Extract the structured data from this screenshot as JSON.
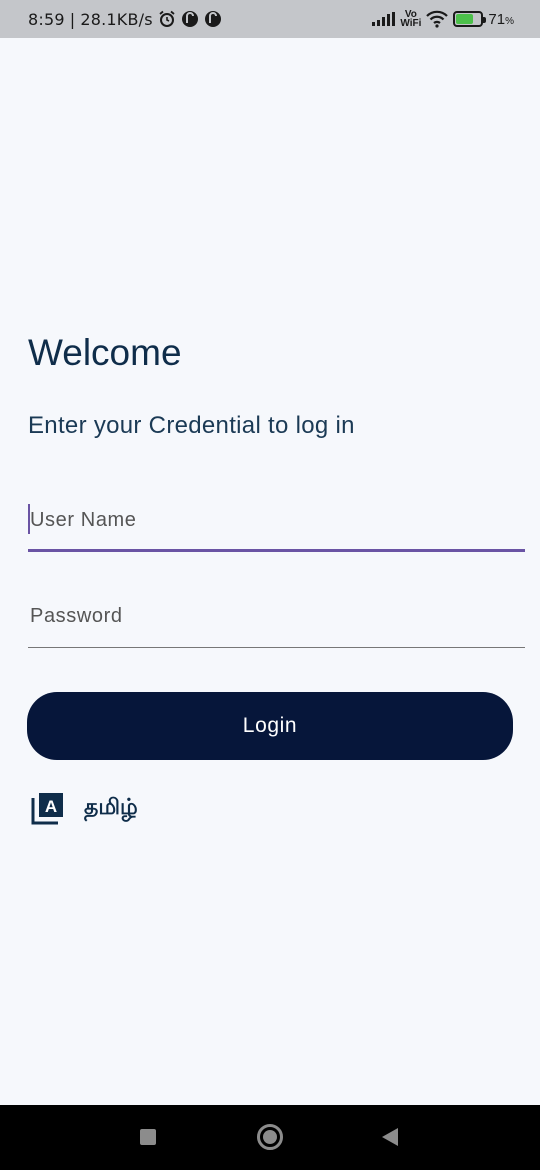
{
  "status_bar": {
    "time": "8:59",
    "separator": "|",
    "network_speed": "28.1KB/s",
    "vowifi_top": "Vo",
    "vowifi_bottom": "WiFi",
    "battery_percent": "71",
    "battery_unit": "%",
    "battery_level": 0.71
  },
  "login": {
    "title": "Welcome",
    "subtitle": "Enter your Credential to log in",
    "username_placeholder": "User Name",
    "username_value": "",
    "password_placeholder": "Password",
    "password_value": "",
    "login_label": "Login"
  },
  "language": {
    "label": "தமிழ்",
    "icon": "translate-icon",
    "icon_letter": "A"
  },
  "colors": {
    "primary_dark": "#06163a",
    "heading": "#0f2d4a",
    "focus_underline": "#6a54a4",
    "background": "#f6f8fc"
  }
}
